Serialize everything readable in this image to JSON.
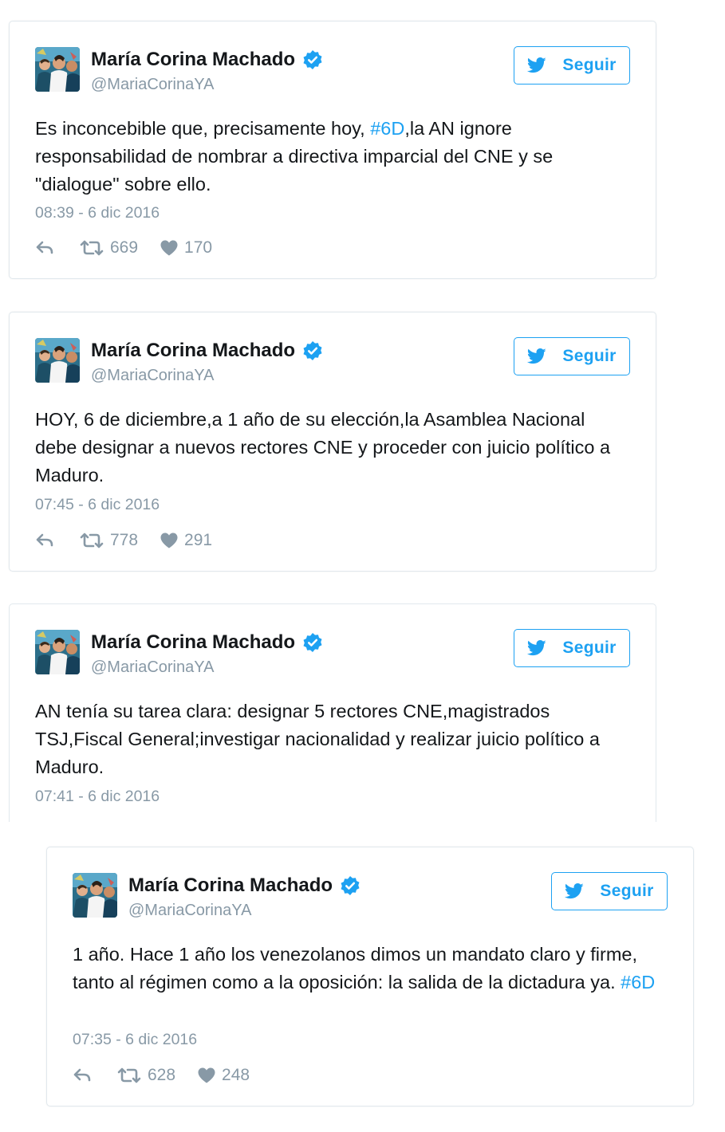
{
  "tweets": [
    {
      "name": "María Corina Machado",
      "handle": "@MariaCorinaYA",
      "follow_label": "Seguir",
      "text_parts": [
        {
          "t": "Es inconcebible que, precisamente hoy, "
        },
        {
          "t": "#6D",
          "tag": true
        },
        {
          "t": ",la AN ignore responsabilidad de nombrar a directiva imparcial del CNE y se \"dialogue\" sobre ello."
        }
      ],
      "date": "08:39 - 6 dic 2016",
      "retweets": "669",
      "likes": "170"
    },
    {
      "name": "María Corina Machado",
      "handle": "@MariaCorinaYA",
      "follow_label": "Seguir",
      "text_parts": [
        {
          "t": "HOY, 6 de diciembre,a 1 año de su elección,la Asamblea Nacional debe designar a nuevos rectores CNE y proceder con juicio político a Maduro."
        }
      ],
      "date": "07:45 - 6 dic 2016",
      "retweets": "778",
      "likes": "291"
    },
    {
      "name": "María Corina Machado",
      "handle": "@MariaCorinaYA",
      "follow_label": "Seguir",
      "text_parts": [
        {
          "t": "AN tenía su tarea clara: designar 5 rectores CNE,magistrados TSJ,Fiscal General;investigar nacionalidad y realizar juicio político a Maduro."
        }
      ],
      "date": "07:41 - 6 dic 2016"
    },
    {
      "name": "María Corina Machado",
      "handle": "@MariaCorinaYA",
      "follow_label": "Seguir",
      "text_parts": [
        {
          "t": "1 año. Hace 1 año los venezolanos dimos un mandato claro y firme, tanto al régimen como a la oposición: la salida de la dictadura ya. "
        },
        {
          "t": "#6D",
          "tag": true
        }
      ],
      "date": "07:35 - 6 dic 2016",
      "retweets": "628",
      "likes": "248"
    }
  ],
  "colors": {
    "accent": "#1da1f2",
    "muted": "#8899a6",
    "text": "#14171a",
    "border": "#e1e8ed"
  },
  "icons": [
    "twitter-bird-icon",
    "verified-badge-icon",
    "reply-icon",
    "retweet-icon",
    "heart-icon"
  ]
}
